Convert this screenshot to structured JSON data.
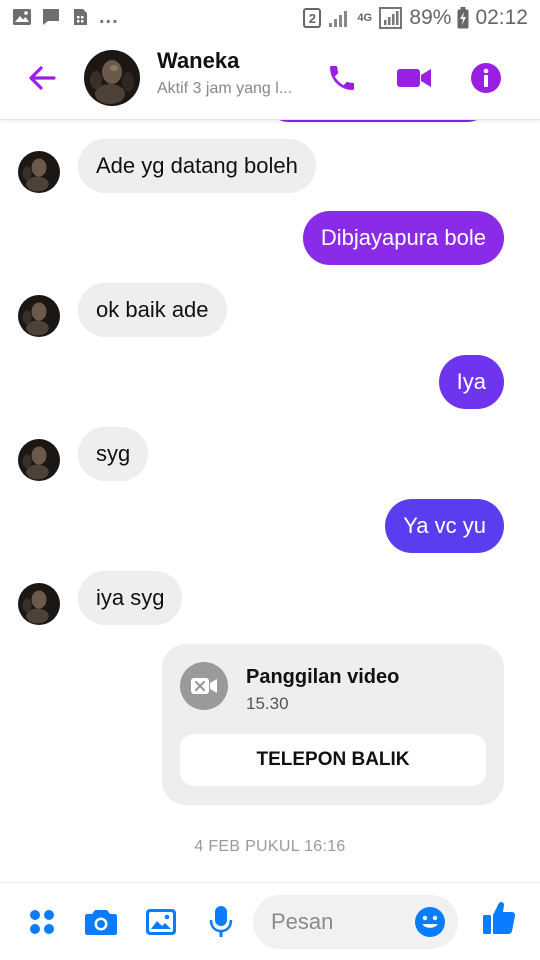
{
  "status_bar": {
    "left_icons": [
      "image-icon",
      "chat-icon",
      "sim-icon"
    ],
    "overflow": "...",
    "sim_badge": "2",
    "network_label": "4G",
    "battery": "89%",
    "time": "02:12"
  },
  "header": {
    "contact_name": "Waneka",
    "status": "Aktif 3 jam yang l...",
    "icons": [
      "back-arrow-icon",
      "phone-icon",
      "video-camera-icon",
      "info-icon"
    ]
  },
  "messages": [
    {
      "direction": "in",
      "text": "Ade yg datang boleh"
    },
    {
      "direction": "out",
      "text": "Dibjayapura bole",
      "color": "#8a2be8"
    },
    {
      "direction": "in",
      "text": "ok baik ade"
    },
    {
      "direction": "out",
      "text": "Iya",
      "color": "#6f35ee"
    },
    {
      "direction": "in",
      "text": "syg"
    },
    {
      "direction": "out",
      "text": "Ya vc yu",
      "color": "#5b3df0"
    },
    {
      "direction": "in",
      "text": "iya syg"
    }
  ],
  "call_card": {
    "title": "Panggilan video",
    "time": "15.30",
    "button_label": "TELEPON BALIK"
  },
  "date_divider": "4 FEB PUKUL 16:16",
  "composer": {
    "placeholder": "Pesan",
    "icons": [
      "apps-icon",
      "camera-icon",
      "gallery-icon",
      "microphone-icon",
      "emoji-icon",
      "thumbs-up-icon"
    ]
  },
  "colors": {
    "accent_purple": "#9b1fe3",
    "accent_blue": "#0a7cff",
    "incoming_bubble": "#eeeeee"
  }
}
